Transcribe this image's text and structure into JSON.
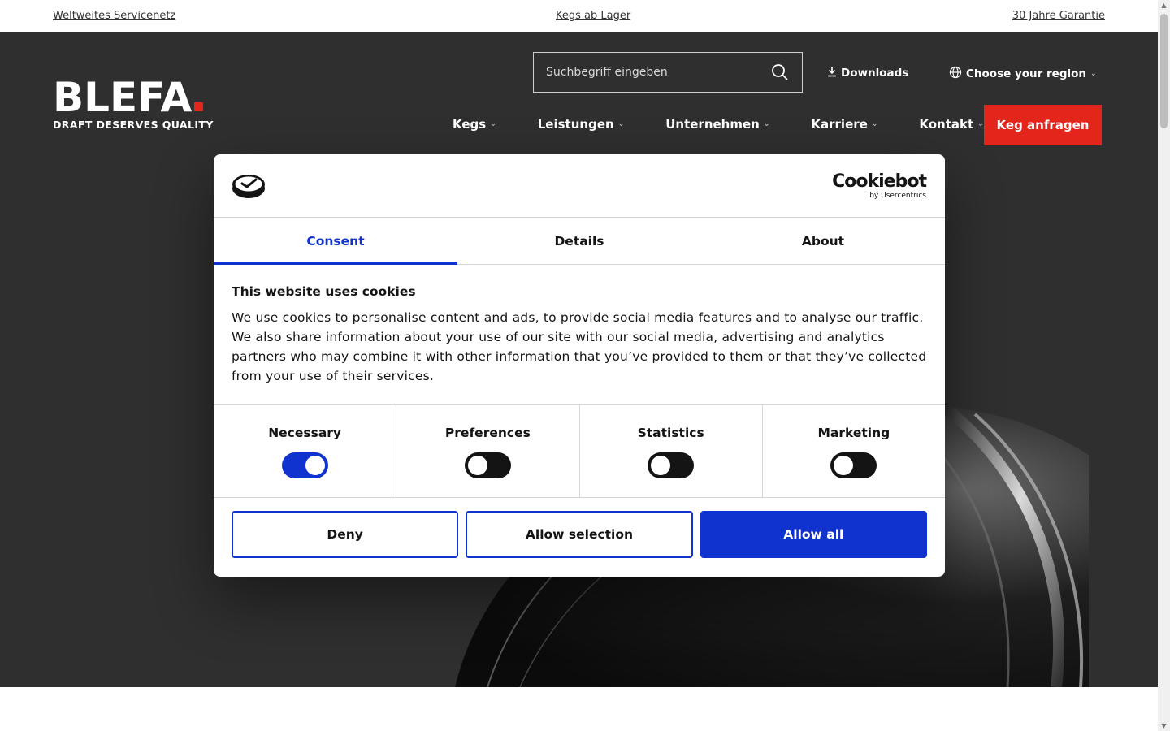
{
  "topbar": {
    "left_link": "Weltweites Servicenetz",
    "center_link": "Kegs ab Lager",
    "right_link": "30 Jahre Garantie"
  },
  "brand": {
    "name": "BLEFA",
    "tagline": "DRAFT DESERVES QUALITY",
    "accent_color": "#e3251b"
  },
  "header": {
    "search_placeholder": "Suchbegriff eingeben",
    "downloads": "Downloads",
    "region": "Choose your region",
    "nav": [
      "Kegs",
      "Leistungen",
      "Unternehmen",
      "Karriere",
      "Kontakt"
    ],
    "cta": "Keg anfragen"
  },
  "cookie_dialog": {
    "brand": "Cookiebot",
    "brand_sub": "by Usercentrics",
    "tabs": [
      "Consent",
      "Details",
      "About"
    ],
    "active_tab": "Consent",
    "title": "This website uses cookies",
    "text": "We use cookies to personalise content and ads, to provide social media features and to analyse our traffic. We also share information about your use of our site with our social media, advertising and analytics partners who may combine it with other information that you’ve provided to them or that they’ve collected from your use of their services.",
    "toggles": [
      {
        "label": "Necessary",
        "on": true
      },
      {
        "label": "Preferences",
        "on": false
      },
      {
        "label": "Statistics",
        "on": false
      },
      {
        "label": "Marketing",
        "on": false
      }
    ],
    "buttons": {
      "deny": "Deny",
      "allow_selection": "Allow selection",
      "allow_all": "Allow all"
    },
    "accent_color": "#1032cf"
  }
}
